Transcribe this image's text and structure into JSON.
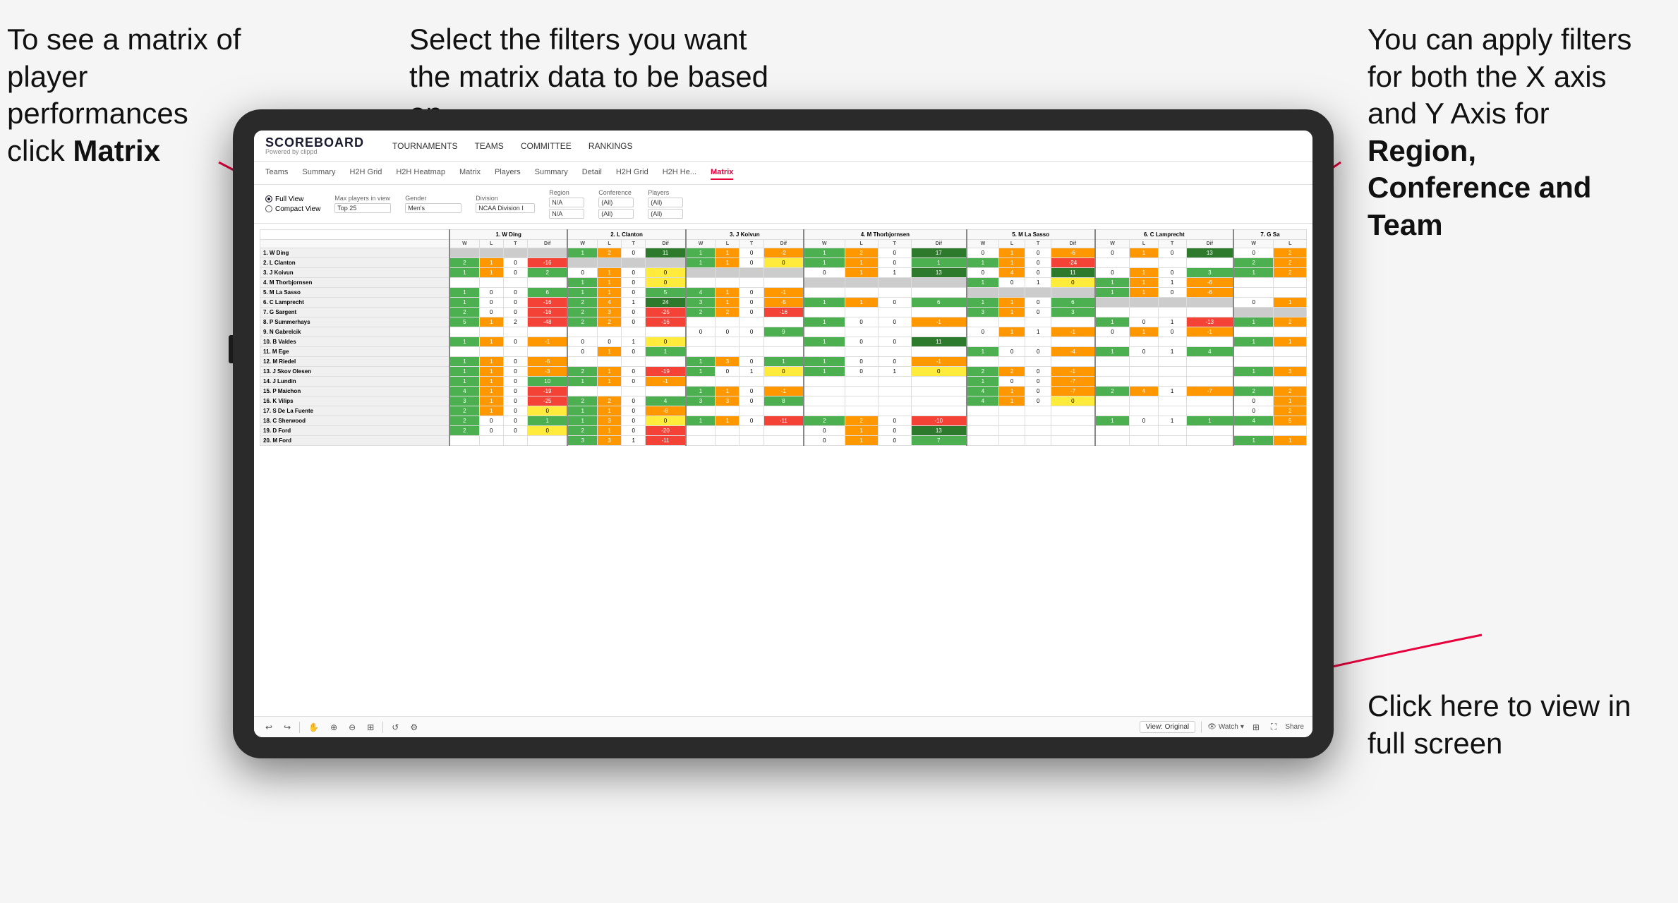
{
  "annotations": {
    "top_left": "To see a matrix of player performances click Matrix",
    "top_left_bold": "Matrix",
    "top_center": "Select the filters you want the matrix data to be based on",
    "top_right_line1": "You  can apply filters for both the X axis and Y Axis for ",
    "top_right_bold": "Region, Conference and Team",
    "bottom_right": "Click here to view in full screen"
  },
  "nav": {
    "logo": "SCOREBOARD",
    "powered_by": "Powered by clippd",
    "main_items": [
      "TOURNAMENTS",
      "TEAMS",
      "COMMITTEE",
      "RANKINGS"
    ],
    "sub_items": [
      "Teams",
      "Summary",
      "H2H Grid",
      "H2H Heatmap",
      "Matrix",
      "Players",
      "Summary",
      "Detail",
      "H2H Grid",
      "H2H He...",
      "Matrix"
    ],
    "active_sub": "Matrix"
  },
  "filters": {
    "view_full": "Full View",
    "view_compact": "Compact View",
    "max_players_label": "Max players in view",
    "max_players_value": "Top 25",
    "gender_label": "Gender",
    "gender_value": "Men's",
    "division_label": "Division",
    "division_value": "NCAA Division I",
    "region_label": "Region",
    "region_value": "N/A",
    "region_value2": "N/A",
    "conference_label": "Conference",
    "conference_value": "(All)",
    "conference_value2": "(All)",
    "players_label": "Players",
    "players_value": "(All)",
    "players_value2": "(All)"
  },
  "toolbar": {
    "view_label": "View: Original",
    "watch_label": "Watch",
    "share_label": "Share"
  },
  "matrix": {
    "column_headers": [
      "1. W Ding",
      "2. L Clanton",
      "3. J Koivun",
      "4. M Thorbjornsen",
      "5. M La Sasso",
      "6. C Lamprecht",
      "7. G Sa"
    ],
    "sub_headers": [
      "W",
      "L",
      "T",
      "Dif"
    ],
    "rows": [
      {
        "name": "1. W Ding",
        "data": [
          [
            null,
            null,
            null,
            null
          ],
          [
            1,
            2,
            0,
            11
          ],
          [
            1,
            1,
            0,
            -2
          ],
          [
            1,
            2,
            0,
            17
          ],
          [
            0,
            1,
            0,
            -6
          ],
          [
            0,
            1,
            0,
            13
          ],
          [
            0,
            2
          ]
        ]
      },
      {
        "name": "2. L Clanton",
        "data": [
          [
            2,
            1,
            0,
            -16
          ],
          [
            null,
            null,
            null,
            null
          ],
          [
            1,
            1,
            0,
            0
          ],
          [
            1,
            1,
            0,
            1
          ],
          [
            1,
            1,
            0,
            -24
          ],
          [
            null,
            null,
            null,
            null
          ],
          [
            2,
            2
          ]
        ]
      },
      {
        "name": "3. J Koivun",
        "data": [
          [
            1,
            1,
            0,
            2
          ],
          [
            0,
            1,
            0,
            0
          ],
          [
            null,
            null,
            null,
            null
          ],
          [
            0,
            1,
            1,
            13
          ],
          [
            0,
            4,
            0,
            11
          ],
          [
            0,
            1,
            0,
            3
          ],
          [
            1,
            2
          ]
        ]
      },
      {
        "name": "4. M Thorbjornsen",
        "data": [
          [
            null,
            null,
            null,
            null
          ],
          [
            1,
            1,
            0,
            0
          ],
          [
            null,
            null,
            null,
            null
          ],
          [
            null,
            null,
            null,
            null
          ],
          [
            1,
            0,
            1,
            0
          ],
          [
            1,
            1,
            1,
            -6
          ],
          [
            null,
            null
          ]
        ]
      },
      {
        "name": "5. M La Sasso",
        "data": [
          [
            1,
            0,
            0,
            6
          ],
          [
            1,
            1,
            0,
            5
          ],
          [
            4,
            1,
            0,
            -1
          ],
          [
            null,
            null,
            null,
            null
          ],
          [
            null,
            null,
            null,
            null
          ],
          [
            1,
            1,
            0,
            -6
          ],
          [
            null,
            null
          ]
        ]
      },
      {
        "name": "6. C Lamprecht",
        "data": [
          [
            1,
            0,
            0,
            -16
          ],
          [
            2,
            4,
            1,
            24
          ],
          [
            3,
            1,
            0,
            -5
          ],
          [
            1,
            1,
            0,
            6
          ],
          [
            1,
            1,
            0,
            6
          ],
          [
            null,
            null,
            null,
            null
          ],
          [
            0,
            1
          ]
        ]
      },
      {
        "name": "7. G Sargent",
        "data": [
          [
            2,
            0,
            0,
            -16
          ],
          [
            2,
            3,
            0,
            -25
          ],
          [
            2,
            2,
            0,
            -16
          ],
          [
            null,
            null,
            null,
            null
          ],
          [
            3,
            1,
            0,
            3
          ],
          [
            null,
            null,
            null,
            null
          ],
          [
            null,
            null
          ]
        ]
      },
      {
        "name": "8. P Summerhays",
        "data": [
          [
            5,
            1,
            2,
            -48
          ],
          [
            2,
            2,
            0,
            -16
          ],
          [
            null,
            null,
            null,
            null
          ],
          [
            1,
            0,
            0,
            -1
          ],
          [
            null,
            null,
            null,
            null
          ],
          [
            1,
            0,
            1,
            -13
          ],
          [
            1,
            2
          ]
        ]
      },
      {
        "name": "9. N Gabrelcik",
        "data": [
          [
            null,
            null,
            null,
            null
          ],
          [
            null,
            null,
            null,
            null
          ],
          [
            0,
            0,
            0,
            9
          ],
          [
            null,
            null,
            null,
            null
          ],
          [
            0,
            1,
            1,
            -1
          ],
          [
            0,
            1,
            0,
            -1
          ],
          [
            null,
            null
          ]
        ]
      },
      {
        "name": "10. B Valdes",
        "data": [
          [
            1,
            1,
            0,
            -1
          ],
          [
            0,
            0,
            1,
            0
          ],
          [
            null,
            null,
            null,
            null
          ],
          [
            1,
            0,
            0,
            11
          ],
          [
            null,
            null,
            null,
            null
          ],
          [
            null,
            null,
            null,
            null
          ],
          [
            1,
            1
          ]
        ]
      },
      {
        "name": "11. M Ege",
        "data": [
          [
            null,
            null,
            null,
            null
          ],
          [
            0,
            1,
            0,
            1
          ],
          [
            null,
            null,
            null,
            null
          ],
          [
            null,
            null,
            null,
            null
          ],
          [
            1,
            0,
            0,
            -4
          ],
          [
            1,
            0,
            1,
            4
          ],
          [
            null,
            null
          ]
        ]
      },
      {
        "name": "12. M Riedel",
        "data": [
          [
            1,
            1,
            0,
            -6
          ],
          [
            null,
            null,
            null,
            null
          ],
          [
            1,
            3,
            0,
            1
          ],
          [
            1,
            0,
            0,
            -1
          ],
          [
            null,
            null,
            null,
            null
          ],
          [
            null,
            null,
            null,
            null
          ],
          [
            null,
            null
          ]
        ]
      },
      {
        "name": "13. J Skov Olesen",
        "data": [
          [
            1,
            1,
            0,
            -3
          ],
          [
            2,
            1,
            0,
            -19
          ],
          [
            1,
            0,
            1,
            0
          ],
          [
            1,
            0,
            1,
            0
          ],
          [
            2,
            2,
            0,
            -1
          ],
          [
            null,
            null,
            null,
            null
          ],
          [
            1,
            3
          ]
        ]
      },
      {
        "name": "14. J Lundin",
        "data": [
          [
            1,
            1,
            0,
            10
          ],
          [
            1,
            1,
            0,
            -1
          ],
          [
            null,
            null,
            null,
            null
          ],
          [
            null,
            null,
            null,
            null
          ],
          [
            1,
            0,
            0,
            -7
          ],
          [
            null,
            null,
            null,
            null
          ],
          [
            null,
            null
          ]
        ]
      },
      {
        "name": "15. P Maichon",
        "data": [
          [
            4,
            1,
            0,
            -19
          ],
          [
            null,
            null,
            null,
            null
          ],
          [
            1,
            1,
            0,
            -1
          ],
          [
            null,
            null,
            null,
            null
          ],
          [
            4,
            1,
            0,
            -7
          ],
          [
            2,
            4,
            1,
            -7
          ],
          [
            2,
            2
          ]
        ]
      },
      {
        "name": "16. K Vilips",
        "data": [
          [
            3,
            1,
            0,
            -25
          ],
          [
            2,
            2,
            0,
            4
          ],
          [
            3,
            3,
            0,
            8
          ],
          [
            null,
            null,
            null,
            null
          ],
          [
            4,
            1,
            0,
            0
          ],
          [
            null,
            null,
            null,
            null
          ],
          [
            0,
            1
          ]
        ]
      },
      {
        "name": "17. S De La Fuente",
        "data": [
          [
            2,
            1,
            0,
            0
          ],
          [
            1,
            1,
            0,
            -8
          ],
          [
            null,
            null,
            null,
            null
          ],
          [
            null,
            null,
            null,
            null
          ],
          [
            null,
            null,
            null,
            null
          ],
          [
            null,
            null,
            null,
            null
          ],
          [
            0,
            2
          ]
        ]
      },
      {
        "name": "18. C Sherwood",
        "data": [
          [
            2,
            0,
            0,
            1
          ],
          [
            1,
            3,
            0,
            0
          ],
          [
            1,
            1,
            0,
            -11
          ],
          [
            2,
            2,
            0,
            -10
          ],
          [
            null,
            null,
            null,
            null
          ],
          [
            1,
            0,
            1,
            1
          ],
          [
            4,
            5
          ]
        ]
      },
      {
        "name": "19. D Ford",
        "data": [
          [
            2,
            0,
            0,
            0
          ],
          [
            2,
            1,
            0,
            -20
          ],
          [
            null,
            null,
            null,
            null
          ],
          [
            0,
            1,
            0,
            13
          ],
          [
            null,
            null,
            null,
            null
          ],
          [
            null,
            null,
            null,
            null
          ],
          [
            null,
            null
          ]
        ]
      },
      {
        "name": "20. M Ford",
        "data": [
          [
            null,
            null,
            null,
            null
          ],
          [
            3,
            3,
            1,
            -11
          ],
          [
            null,
            null,
            null,
            null
          ],
          [
            0,
            1,
            0,
            7
          ],
          [
            null,
            null,
            null,
            null
          ],
          [
            null,
            null,
            null,
            null
          ],
          [
            1,
            1
          ]
        ]
      }
    ]
  }
}
